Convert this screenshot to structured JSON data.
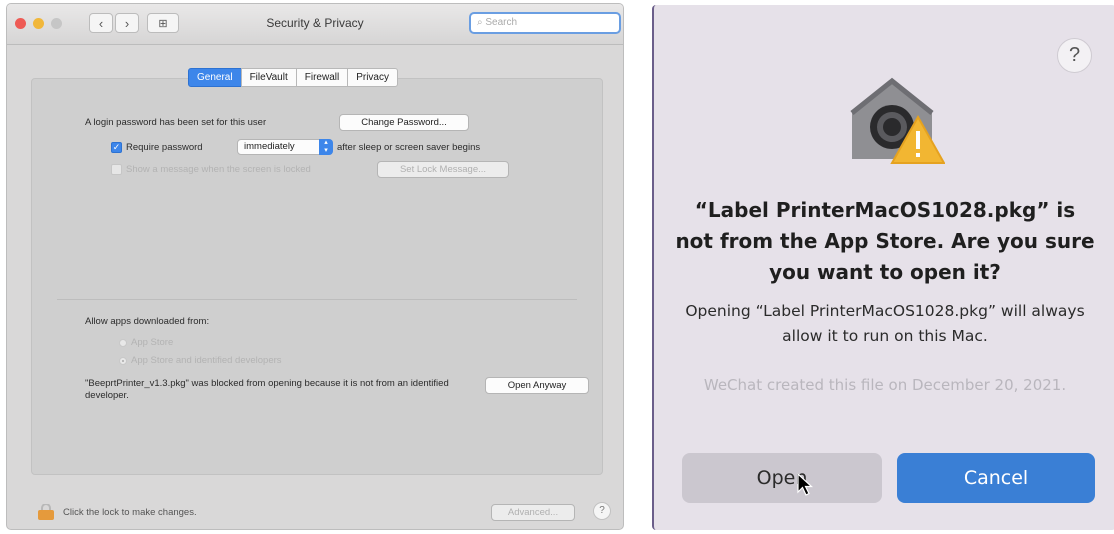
{
  "left_window": {
    "title": "Security & Privacy",
    "nav": {
      "back": "‹",
      "forward": "›",
      "grid": "⊞"
    },
    "search_placeholder": "Search",
    "tabs": [
      "General",
      "FileVault",
      "Firewall",
      "Privacy"
    ],
    "login_label": "A login password has been set for this user",
    "change_password_button": "Change Password...",
    "require_password_label": "Require password",
    "require_password_value": "immediately",
    "after_sleep_label": "after sleep or screen saver begins",
    "show_message_label": "Show a message when the screen is locked",
    "set_lock_message_button": "Set Lock Message...",
    "allow_apps_label": "Allow apps downloaded from:",
    "option_app_store": "App Store",
    "option_identified": "App Store and identified developers",
    "blocked_message": "\"BeeprtPrinter_v1.3.pkg\" was blocked from opening because it is not from an identified developer.",
    "open_anyway_button": "Open Anyway",
    "lock_label": "Click the lock to make changes.",
    "advanced_button": "Advanced...",
    "help": "?"
  },
  "dialog": {
    "help": "?",
    "heading": "“Label PrinterMacOS1028.pkg” is not from the App Store. Are you sure you want to open it?",
    "body": "Opening “Label PrinterMacOS1028.pkg” will always allow it to run on this Mac.",
    "info": "WeChat created this file on December 20, 2021.",
    "open_button": "Open",
    "cancel_button": "Cancel"
  },
  "colors": {
    "accent": "#3d86ea",
    "cancel": "#3a7fd5",
    "warning": "#f2b632"
  }
}
